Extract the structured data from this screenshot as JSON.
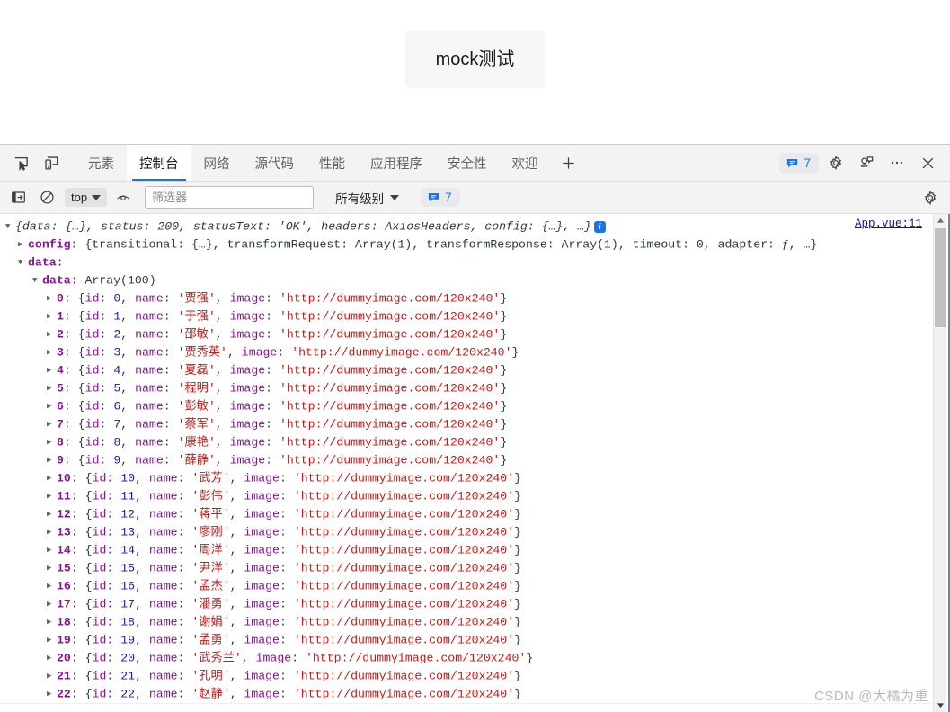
{
  "page": {
    "button_label": "mock测试"
  },
  "devtools": {
    "tabs": [
      {
        "label": "元素",
        "active": false
      },
      {
        "label": "控制台",
        "active": true
      },
      {
        "label": "网络",
        "active": false
      },
      {
        "label": "源代码",
        "active": false
      },
      {
        "label": "性能",
        "active": false
      },
      {
        "label": "应用程序",
        "active": false
      },
      {
        "label": "安全性",
        "active": false
      },
      {
        "label": "欢迎",
        "active": false
      }
    ],
    "add_tab_label": "+",
    "issues_count": "7",
    "icons": {
      "inspect": "inspect-element-icon",
      "device": "device-toolbar-icon",
      "settings": "gear-icon",
      "feedback": "feedback-icon",
      "more": "more-options-icon",
      "close": "close-icon"
    }
  },
  "filterbar": {
    "sidebar_toggle": "console-sidebar-icon",
    "clear_label": "clear-console-icon",
    "context": "top",
    "eye_icon": "live-expression-icon",
    "filter_value": "",
    "filter_placeholder": "筛选器",
    "level": "所有级别",
    "issues_count": "7",
    "settings_icon": "gear-icon"
  },
  "console": {
    "source_link": "App.vue:11",
    "summary": {
      "prefix": "{",
      "parts": "data: {…}, status: 200, statusText: 'OK', headers: AxiosHeaders, config: {…}, …",
      "suffix": "}"
    },
    "config_line": {
      "key": "config",
      "value": "{transitional: {…}, transformRequest: Array(1), transformResponse: Array(1), timeout: 0, adapter: ƒ, …}"
    },
    "data_line_key": "data",
    "array_line": {
      "key": "data",
      "value": "Array(100)"
    },
    "image_url": "http://dummyimage.com/120x240",
    "rows": [
      {
        "index": "0",
        "id": "0",
        "name": "贾强"
      },
      {
        "index": "1",
        "id": "1",
        "name": "于强"
      },
      {
        "index": "2",
        "id": "2",
        "name": "邵敏"
      },
      {
        "index": "3",
        "id": "3",
        "name": "贾秀英"
      },
      {
        "index": "4",
        "id": "4",
        "name": "夏磊"
      },
      {
        "index": "5",
        "id": "5",
        "name": "程明"
      },
      {
        "index": "6",
        "id": "6",
        "name": "彭敏"
      },
      {
        "index": "7",
        "id": "7",
        "name": "蔡军"
      },
      {
        "index": "8",
        "id": "8",
        "name": "康艳"
      },
      {
        "index": "9",
        "id": "9",
        "name": "薛静"
      },
      {
        "index": "10",
        "id": "10",
        "name": "武芳"
      },
      {
        "index": "11",
        "id": "11",
        "name": "彭伟"
      },
      {
        "index": "12",
        "id": "12",
        "name": "蒋平"
      },
      {
        "index": "13",
        "id": "13",
        "name": "廖刚"
      },
      {
        "index": "14",
        "id": "14",
        "name": "周洋"
      },
      {
        "index": "15",
        "id": "15",
        "name": "尹洋"
      },
      {
        "index": "16",
        "id": "16",
        "name": "孟杰"
      },
      {
        "index": "17",
        "id": "17",
        "name": "潘勇"
      },
      {
        "index": "18",
        "id": "18",
        "name": "谢娟"
      },
      {
        "index": "19",
        "id": "19",
        "name": "孟勇"
      },
      {
        "index": "20",
        "id": "20",
        "name": "武秀兰"
      },
      {
        "index": "21",
        "id": "21",
        "name": "孔明"
      },
      {
        "index": "22",
        "id": "22",
        "name": "赵静"
      }
    ]
  },
  "watermark": "CSDN @大橘为重",
  "colors": {
    "accent": "#1a73e8",
    "property": "#881391",
    "string": "#c41a16",
    "number": "#1a1aa6",
    "link": "#1a0dab"
  }
}
